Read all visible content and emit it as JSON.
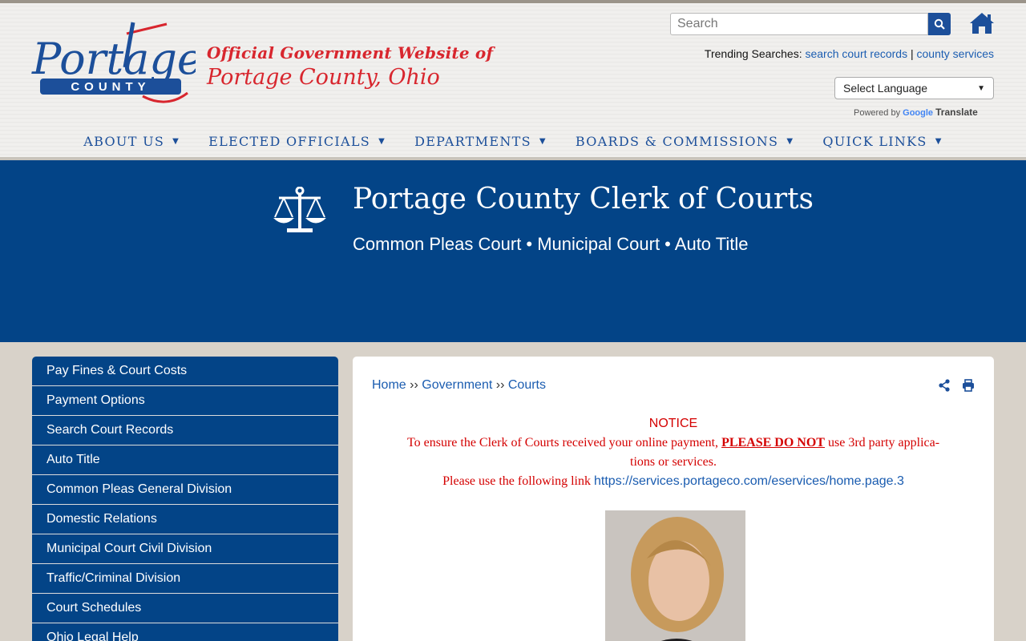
{
  "header": {
    "logo_text": "Portage",
    "logo_sub": "COUNTY",
    "tagline_line1": "Official Government Website of",
    "tagline_line2": "Portage County, Ohio",
    "search_placeholder": "Search",
    "trending_label": "Trending Searches:",
    "trending_links": [
      "search court records",
      "county services"
    ],
    "trending_separator": "|",
    "language_select": "Select Language",
    "powered_by": "Powered by",
    "google": "Google",
    "translate": "Translate"
  },
  "nav": {
    "items": [
      {
        "label": "ABOUT US"
      },
      {
        "label": "ELECTED OFFICIALS"
      },
      {
        "label": "DEPARTMENTS"
      },
      {
        "label": "BOARDS & COMMISSIONS"
      },
      {
        "label": "QUICK LINKS"
      }
    ]
  },
  "banner": {
    "title": "Portage County Clerk of Courts",
    "subtitle": "Common Pleas Court • Municipal Court • Auto Title"
  },
  "sidebar": {
    "items": [
      "Pay Fines & Court Costs",
      "Payment Options",
      "Search Court Records",
      "Auto Title",
      "Common Pleas General Division",
      "Domestic Relations",
      "Municipal Court Civil Division",
      "Traffic/Criminal Division",
      "Court Schedules",
      "Ohio Legal Help"
    ]
  },
  "content": {
    "breadcrumb": [
      "Home",
      "Government",
      "Courts"
    ],
    "breadcrumb_sep": "››",
    "notice_title": "NOTICE",
    "notice_line1_pre": "To ensure the Clerk of Courts received your online payment, ",
    "notice_dont": "PLEASE DO NOT",
    "notice_line1_post": " use 3rd party applica-",
    "notice_line2": "tions or services.",
    "notice_line3_pre": "Please use the following link ",
    "notice_link": "https://services.portageco.com/eservices/home.page.3"
  },
  "colors": {
    "brand_blue": "#034487",
    "brand_red": "#d8262e",
    "link_blue": "#1a5cb0"
  }
}
